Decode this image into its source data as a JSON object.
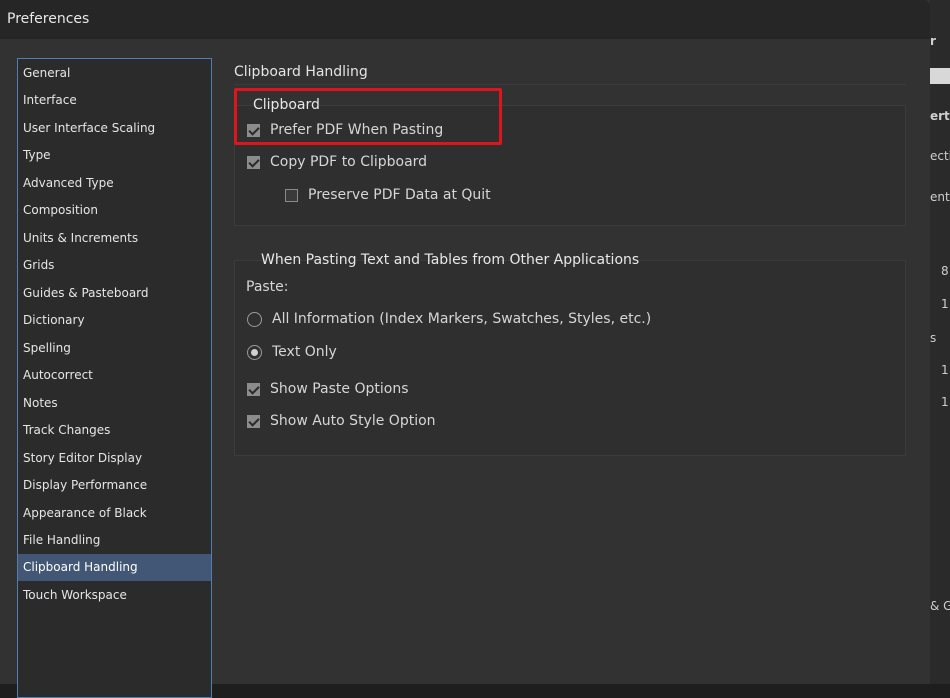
{
  "window": {
    "title": "Preferences"
  },
  "sidebar": {
    "items": [
      {
        "label": "General"
      },
      {
        "label": "Interface"
      },
      {
        "label": "User Interface Scaling"
      },
      {
        "label": "Type"
      },
      {
        "label": "Advanced Type"
      },
      {
        "label": "Composition"
      },
      {
        "label": "Units & Increments"
      },
      {
        "label": "Grids"
      },
      {
        "label": "Guides & Pasteboard"
      },
      {
        "label": "Dictionary"
      },
      {
        "label": "Spelling"
      },
      {
        "label": "Autocorrect"
      },
      {
        "label": "Notes"
      },
      {
        "label": "Track Changes"
      },
      {
        "label": "Story Editor Display"
      },
      {
        "label": "Display Performance"
      },
      {
        "label": "Appearance of Black"
      },
      {
        "label": "File Handling"
      },
      {
        "label": "Clipboard Handling",
        "selected": true
      },
      {
        "label": "Touch Workspace"
      }
    ]
  },
  "main": {
    "section_title": "Clipboard Handling",
    "clipboard_group": {
      "title": "Clipboard",
      "prefer_pdf": {
        "label": "Prefer PDF When Pasting",
        "checked": true
      },
      "copy_pdf": {
        "label": "Copy PDF to Clipboard",
        "checked": true
      },
      "preserve_pdf": {
        "label": "Preserve PDF Data at Quit",
        "checked": false
      }
    },
    "paste_group": {
      "title": "When Pasting Text and Tables from Other Applications",
      "paste_label": "Paste:",
      "all_info": {
        "label": "All Information (Index Markers, Swatches, Styles, etc.)",
        "selected": false
      },
      "text_only": {
        "label": "Text Only",
        "selected": true
      },
      "show_paste_options": {
        "label": "Show Paste Options",
        "checked": true
      },
      "show_auto_style": {
        "label": "Show Auto Style Option",
        "checked": true
      }
    }
  },
  "background_app": {
    "fragments": [
      "r",
      "erti",
      "ectio",
      "ent",
      "8",
      "1",
      "s",
      "1",
      "1",
      "& Gr"
    ]
  },
  "colors": {
    "highlight": "#e0141b",
    "selected_item": "#425775",
    "sidebar_border": "#4f7fb0"
  }
}
